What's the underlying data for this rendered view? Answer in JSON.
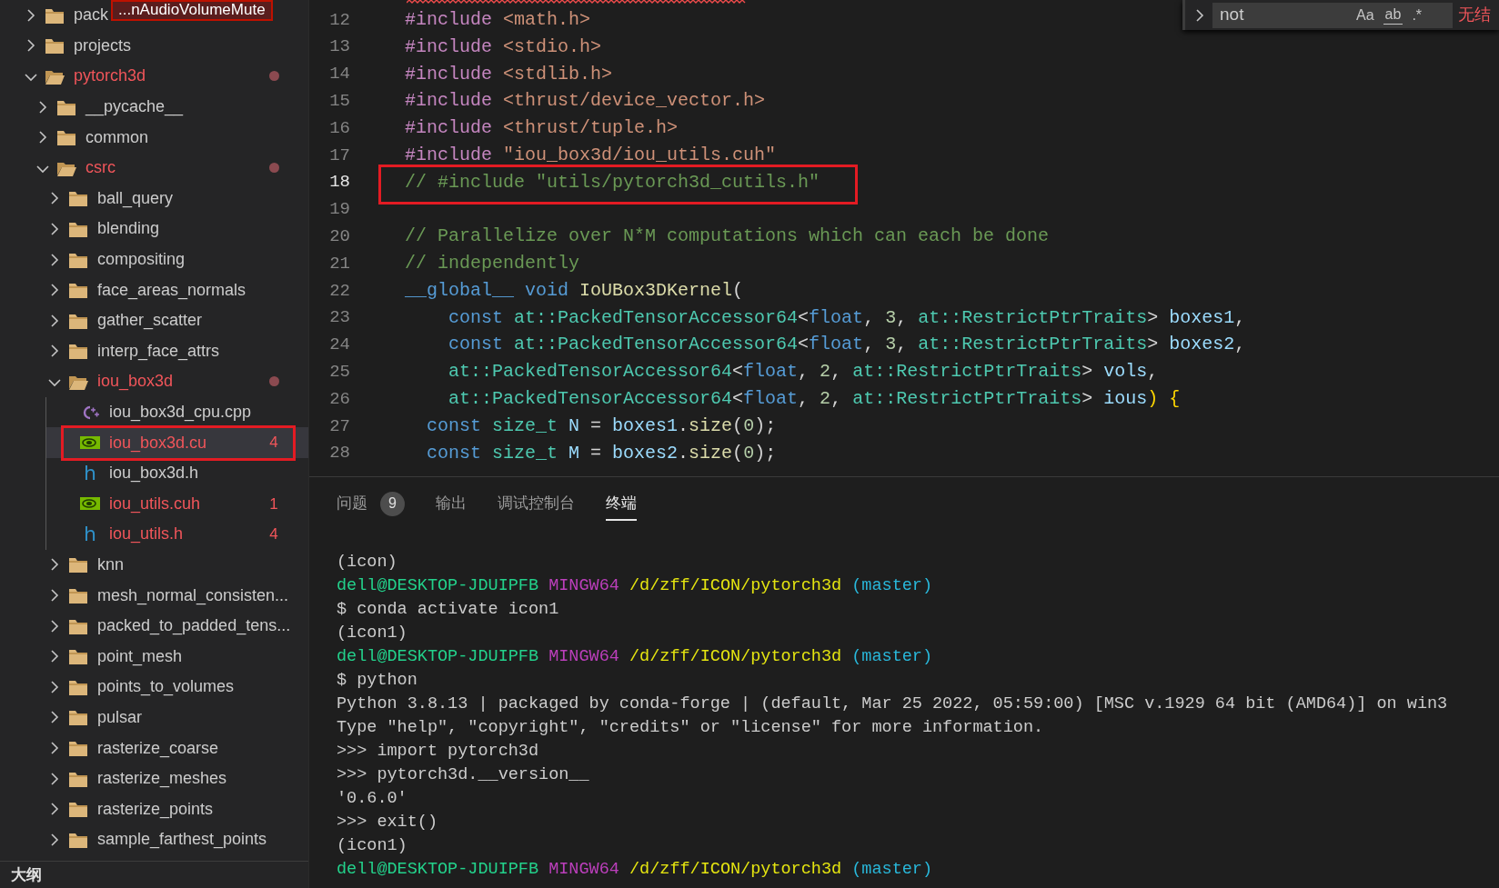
{
  "explorer": {
    "tooltip": {
      "text": "...nAudioVolumeMute"
    },
    "tree": [
      {
        "label": "pack",
        "kind": "folder",
        "expanded": false,
        "selected": false,
        "error": false,
        "dot": false,
        "annotated": false
      },
      {
        "label": "projects",
        "kind": "folder",
        "expanded": false,
        "selected": false,
        "error": false,
        "dot": false,
        "annotated": false
      },
      {
        "label": "pytorch3d",
        "kind": "folder",
        "expanded": true,
        "selected": false,
        "error": true,
        "dot": true,
        "annotated": false,
        "children": [
          {
            "label": "__pycache__",
            "kind": "folder",
            "expanded": false,
            "selected": false,
            "error": false,
            "dot": false,
            "annotated": false
          },
          {
            "label": "common",
            "kind": "folder",
            "expanded": false,
            "selected": false,
            "error": false,
            "dot": false,
            "annotated": false
          },
          {
            "label": "csrc",
            "kind": "folder",
            "expanded": true,
            "selected": false,
            "error": true,
            "dot": true,
            "annotated": false,
            "children": [
              {
                "label": "ball_query",
                "kind": "folder",
                "expanded": false,
                "selected": false,
                "error": false,
                "dot": false,
                "annotated": false
              },
              {
                "label": "blending",
                "kind": "folder",
                "expanded": false,
                "selected": false,
                "error": false,
                "dot": false,
                "annotated": false
              },
              {
                "label": "compositing",
                "kind": "folder",
                "expanded": false,
                "selected": false,
                "error": false,
                "dot": false,
                "annotated": false
              },
              {
                "label": "face_areas_normals",
                "kind": "folder",
                "expanded": false,
                "selected": false,
                "error": false,
                "dot": false,
                "annotated": false
              },
              {
                "label": "gather_scatter",
                "kind": "folder",
                "expanded": false,
                "selected": false,
                "error": false,
                "dot": false,
                "annotated": false
              },
              {
                "label": "interp_face_attrs",
                "kind": "folder",
                "expanded": false,
                "selected": false,
                "error": false,
                "dot": false,
                "annotated": false
              },
              {
                "label": "iou_box3d",
                "kind": "folder",
                "expanded": true,
                "selected": false,
                "error": true,
                "dot": true,
                "annotated": false,
                "children": [
                  {
                    "label": "iou_box3d_cpu.cpp",
                    "kind": "cpp",
                    "selected": false,
                    "error": false,
                    "dot": false,
                    "annotated": false
                  },
                  {
                    "label": "iou_box3d.cu",
                    "kind": "cuda",
                    "selected": true,
                    "error": true,
                    "dot": false,
                    "annotated": true,
                    "count": "4"
                  },
                  {
                    "label": "iou_box3d.h",
                    "kind": "header",
                    "icon_text": "h",
                    "selected": false,
                    "error": false,
                    "dot": false,
                    "annotated": false
                  },
                  {
                    "label": "iou_utils.cuh",
                    "kind": "cuda",
                    "selected": false,
                    "error": true,
                    "dot": false,
                    "annotated": false,
                    "count": "1"
                  },
                  {
                    "label": "iou_utils.h",
                    "kind": "header",
                    "icon_text": "h",
                    "selected": false,
                    "error": true,
                    "dot": false,
                    "annotated": false,
                    "count": "4"
                  }
                ]
              },
              {
                "label": "knn",
                "kind": "folder",
                "expanded": false,
                "selected": false,
                "error": false,
                "dot": false,
                "annotated": false
              },
              {
                "label": "mesh_normal_consisten...",
                "kind": "folder",
                "expanded": false,
                "selected": false,
                "error": false,
                "dot": false,
                "annotated": false
              },
              {
                "label": "packed_to_padded_tens...",
                "kind": "folder",
                "expanded": false,
                "selected": false,
                "error": false,
                "dot": false,
                "annotated": false
              },
              {
                "label": "point_mesh",
                "kind": "folder",
                "expanded": false,
                "selected": false,
                "error": false,
                "dot": false,
                "annotated": false
              },
              {
                "label": "points_to_volumes",
                "kind": "folder",
                "expanded": false,
                "selected": false,
                "error": false,
                "dot": false,
                "annotated": false
              },
              {
                "label": "pulsar",
                "kind": "folder",
                "expanded": false,
                "selected": false,
                "error": false,
                "dot": false,
                "annotated": false
              },
              {
                "label": "rasterize_coarse",
                "kind": "folder",
                "expanded": false,
                "selected": false,
                "error": false,
                "dot": false,
                "annotated": false
              },
              {
                "label": "rasterize_meshes",
                "kind": "folder",
                "expanded": false,
                "selected": false,
                "error": false,
                "dot": false,
                "annotated": false
              },
              {
                "label": "rasterize_points",
                "kind": "folder",
                "expanded": false,
                "selected": false,
                "error": false,
                "dot": false,
                "annotated": false
              },
              {
                "label": "sample_farthest_points",
                "kind": "folder",
                "expanded": false,
                "selected": false,
                "error": false,
                "dot": false,
                "annotated": false
              }
            ]
          }
        ]
      }
    ],
    "outline": {
      "label": "大纲"
    }
  },
  "find_widget": {
    "value": "not",
    "match_case": "Aa",
    "whole_word": "ab",
    "regex": ".*",
    "result": "无结"
  },
  "editor": {
    "lines": [
      {
        "number": "12",
        "current": false,
        "annotated": false,
        "tokens": [
          {
            "kind": "pp",
            "text": "#include"
          },
          {
            "kind": "str",
            "text": " <math.h>"
          }
        ]
      },
      {
        "number": "13",
        "current": false,
        "annotated": false,
        "tokens": [
          {
            "kind": "pp",
            "text": "#include"
          },
          {
            "kind": "str",
            "text": " <stdio.h>"
          }
        ]
      },
      {
        "number": "14",
        "current": false,
        "annotated": false,
        "tokens": [
          {
            "kind": "pp",
            "text": "#include"
          },
          {
            "kind": "str",
            "text": " <stdlib.h>"
          }
        ]
      },
      {
        "number": "15",
        "current": false,
        "annotated": false,
        "tokens": [
          {
            "kind": "pp",
            "text": "#include"
          },
          {
            "kind": "str",
            "text": " <thrust/device_vector.h>"
          }
        ]
      },
      {
        "number": "16",
        "current": false,
        "annotated": false,
        "tokens": [
          {
            "kind": "pp",
            "text": "#include"
          },
          {
            "kind": "str",
            "text": " <thrust/tuple.h>"
          }
        ]
      },
      {
        "number": "17",
        "current": false,
        "annotated": false,
        "tokens": [
          {
            "kind": "pp",
            "text": "#include"
          },
          {
            "kind": "str",
            "text": " \"iou_box3d/iou_utils.cuh\""
          }
        ]
      },
      {
        "number": "18",
        "current": true,
        "annotated": true,
        "tokens": [
          {
            "kind": "com",
            "text": "// #include \"utils/pytorch3d_cutils.h\""
          }
        ]
      },
      {
        "number": "19",
        "current": false,
        "annotated": false
      },
      {
        "number": "20",
        "current": false,
        "annotated": false,
        "tokens": [
          {
            "kind": "com",
            "text": "// Parallelize over N*M computations which can each be done"
          }
        ]
      },
      {
        "number": "21",
        "current": false,
        "annotated": false,
        "tokens": [
          {
            "kind": "com",
            "text": "// independently"
          }
        ]
      },
      {
        "number": "22",
        "current": false,
        "annotated": false,
        "tokens": [
          {
            "kind": "kw",
            "text": "__global__ void"
          },
          {
            "kind": "fn",
            "text": " IoUBox3DKernel"
          },
          {
            "kind": "p",
            "text": "("
          }
        ]
      },
      {
        "number": "23",
        "current": false,
        "annotated": false,
        "tokens": [
          {
            "kind": "kw",
            "text": "    const"
          },
          {
            "kind": "type",
            "text": " at::PackedTensorAccessor64"
          },
          {
            "kind": "p",
            "text": "<"
          },
          {
            "kind": "kw",
            "text": "float"
          },
          {
            "kind": "p",
            "text": ", "
          },
          {
            "kind": "num",
            "text": "3"
          },
          {
            "kind": "p",
            "text": ", "
          },
          {
            "kind": "type",
            "text": "at::RestrictPtrTraits"
          },
          {
            "kind": "p",
            "text": "> "
          },
          {
            "kind": "var",
            "text": "boxes1"
          },
          {
            "kind": "p",
            "text": ","
          }
        ]
      },
      {
        "number": "24",
        "current": false,
        "annotated": false,
        "tokens": [
          {
            "kind": "kw",
            "text": "    const"
          },
          {
            "kind": "type",
            "text": " at::PackedTensorAccessor64"
          },
          {
            "kind": "p",
            "text": "<"
          },
          {
            "kind": "kw",
            "text": "float"
          },
          {
            "kind": "p",
            "text": ", "
          },
          {
            "kind": "num",
            "text": "3"
          },
          {
            "kind": "p",
            "text": ", "
          },
          {
            "kind": "type",
            "text": "at::RestrictPtrTraits"
          },
          {
            "kind": "p",
            "text": "> "
          },
          {
            "kind": "var",
            "text": "boxes2"
          },
          {
            "kind": "p",
            "text": ","
          }
        ]
      },
      {
        "number": "25",
        "current": false,
        "annotated": false,
        "tokens": [
          {
            "kind": "type",
            "text": "    at::PackedTensorAccessor64"
          },
          {
            "kind": "p",
            "text": "<"
          },
          {
            "kind": "kw",
            "text": "float"
          },
          {
            "kind": "p",
            "text": ", "
          },
          {
            "kind": "num",
            "text": "2"
          },
          {
            "kind": "p",
            "text": ", "
          },
          {
            "kind": "type",
            "text": "at::RestrictPtrTraits"
          },
          {
            "kind": "p",
            "text": "> "
          },
          {
            "kind": "var",
            "text": "vols"
          },
          {
            "kind": "p",
            "text": ","
          }
        ]
      },
      {
        "number": "26",
        "current": false,
        "annotated": false,
        "tokens": [
          {
            "kind": "type",
            "text": "    at::PackedTensorAccessor64"
          },
          {
            "kind": "p",
            "text": "<"
          },
          {
            "kind": "kw",
            "text": "float"
          },
          {
            "kind": "p",
            "text": ", "
          },
          {
            "kind": "num",
            "text": "2"
          },
          {
            "kind": "p",
            "text": ", "
          },
          {
            "kind": "type",
            "text": "at::RestrictPtrTraits"
          },
          {
            "kind": "p",
            "text": "> "
          },
          {
            "kind": "var",
            "text": "ious"
          },
          {
            "kind": "brace",
            "text": ") {"
          }
        ]
      },
      {
        "number": "27",
        "current": false,
        "annotated": false,
        "tokens": [
          {
            "kind": "kw",
            "text": "  const"
          },
          {
            "kind": "type",
            "text": " size_t"
          },
          {
            "kind": "var",
            "text": " N"
          },
          {
            "kind": "p",
            "text": " = "
          },
          {
            "kind": "var",
            "text": "boxes1"
          },
          {
            "kind": "p",
            "text": "."
          },
          {
            "kind": "fn",
            "text": "size"
          },
          {
            "kind": "p",
            "text": "("
          },
          {
            "kind": "num",
            "text": "0"
          },
          {
            "kind": "p",
            "text": ");"
          }
        ]
      },
      {
        "number": "28",
        "current": false,
        "annotated": false,
        "tokens": [
          {
            "kind": "kw",
            "text": "  const"
          },
          {
            "kind": "type",
            "text": " size_t"
          },
          {
            "kind": "var",
            "text": " M"
          },
          {
            "kind": "p",
            "text": " = "
          },
          {
            "kind": "var",
            "text": "boxes2"
          },
          {
            "kind": "p",
            "text": "."
          },
          {
            "kind": "fn",
            "text": "size"
          },
          {
            "kind": "p",
            "text": "("
          },
          {
            "kind": "num",
            "text": "0"
          },
          {
            "kind": "p",
            "text": ");"
          }
        ]
      }
    ]
  },
  "panel": {
    "tabs": [
      {
        "label": "问题",
        "selected": false,
        "badge": "9"
      },
      {
        "label": "输出",
        "selected": false
      },
      {
        "label": "调试控制台",
        "selected": false
      },
      {
        "label": "终端",
        "selected": true
      }
    ],
    "terminal": [
      {
        "kind": "text",
        "text": "(icon)"
      },
      {
        "kind": "prompt",
        "user_host": "dell@DESKTOP-JDUIPFB",
        "system": "MINGW64",
        "path": "/d/zff/ICON/pytorch3d",
        "branch": "(master)"
      },
      {
        "kind": "text",
        "text": "$ conda activate icon1"
      },
      {
        "kind": "text",
        "text": "(icon1)"
      },
      {
        "kind": "prompt",
        "user_host": "dell@DESKTOP-JDUIPFB",
        "system": "MINGW64",
        "path": "/d/zff/ICON/pytorch3d",
        "branch": "(master)"
      },
      {
        "kind": "text",
        "text": "$ python"
      },
      {
        "kind": "text",
        "text": "Python 3.8.13 | packaged by conda-forge | (default, Mar 25 2022, 05:59:00) [MSC v.1929 64 bit (AMD64)] on win3"
      },
      {
        "kind": "text",
        "text": "Type \"help\", \"copyright\", \"credits\" or \"license\" for more information."
      },
      {
        "kind": "text",
        "text": ">>> import pytorch3d"
      },
      {
        "kind": "text",
        "text": ">>> pytorch3d.__version__"
      },
      {
        "kind": "text",
        "text": "'0.6.0'"
      },
      {
        "kind": "text",
        "text": ">>> exit()"
      },
      {
        "kind": "text",
        "text": "(icon1)"
      },
      {
        "kind": "prompt",
        "user_host": "dell@DESKTOP-JDUIPFB",
        "system": "MINGW64",
        "path": "/d/zff/ICON/pytorch3d",
        "branch": "(master)"
      }
    ]
  }
}
